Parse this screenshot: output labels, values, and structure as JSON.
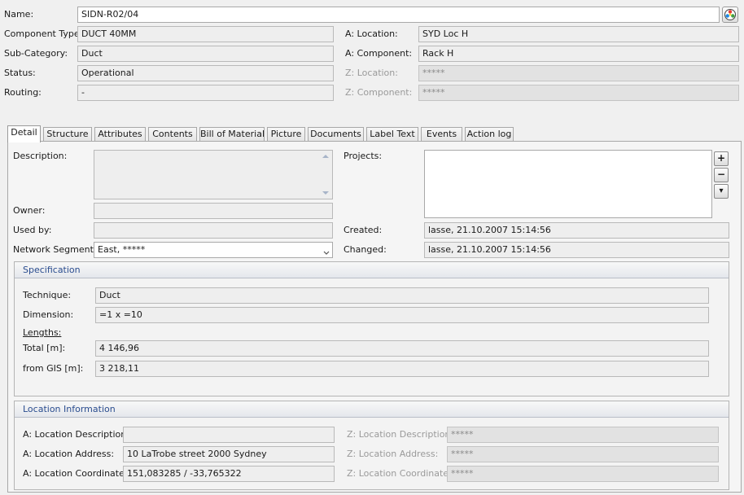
{
  "header": {
    "name_label": "Name:",
    "name_value": "SIDN-R02/04",
    "name_icon": "color-wheel-icon",
    "component_type_label": "Component Type:",
    "component_type_value": "DUCT 40MM",
    "sub_category_label": "Sub-Category:",
    "sub_category_value": "Duct",
    "status_label": "Status:",
    "status_value": "Operational",
    "routing_label": "Routing:",
    "routing_value": "-",
    "a_location_label": "A: Location:",
    "a_location_value": "SYD Loc H",
    "a_component_label": "A: Component:",
    "a_component_value": "Rack H",
    "z_location_label": "Z: Location:",
    "z_location_value": "*****",
    "z_component_label": "Z: Component:",
    "z_component_value": "*****"
  },
  "tabs": [
    "Detail",
    "Structure",
    "Attributes",
    "Contents",
    "Bill of Material",
    "Picture",
    "Documents",
    "Label Text",
    "Events",
    "Action log"
  ],
  "active_tab": "Detail",
  "detail": {
    "description_label": "Description:",
    "description_value": "",
    "owner_label": "Owner:",
    "owner_value": "",
    "used_by_label": "Used by:",
    "used_by_value": "",
    "network_segments_label": "Network Segments:",
    "network_segments_value": "East, *****",
    "projects_label": "Projects:",
    "projects_add": "+",
    "projects_remove": "−",
    "projects_more": "▾",
    "created_label": "Created:",
    "created_value": "lasse, 21.10.2007 15:14:56",
    "changed_label": "Changed:",
    "changed_value": "lasse, 21.10.2007 15:14:56"
  },
  "specification": {
    "title": "Specification",
    "technique_label": "Technique:",
    "technique_value": "Duct",
    "dimension_label": "Dimension:",
    "dimension_value": "=1 x =10",
    "lengths_label": "Lengths:",
    "total_label": "Total [m]:",
    "total_value": "4 146,96",
    "from_gis_label": "from GIS [m]:",
    "from_gis_value": "3 218,11"
  },
  "location_info": {
    "title": "Location Information",
    "a_desc_label": "A: Location Description:",
    "a_desc_value": "",
    "a_addr_label": "A: Location Address:",
    "a_addr_value": "10 LaTrobe street 2000 Sydney",
    "a_coord_label": "A: Location Coordinates:",
    "a_coord_value": "151,083285 / -33,765322",
    "z_desc_label": "Z: Location Description:",
    "z_desc_value": "*****",
    "z_addr_label": "Z: Location Address:",
    "z_addr_value": "*****",
    "z_coord_label": "Z: Location Coordinates:",
    "z_coord_value": "*****"
  },
  "colors": {
    "group_title": "#2a4d8f",
    "background": "#f0f0f0",
    "field_disabled": "#e2e2e2"
  }
}
